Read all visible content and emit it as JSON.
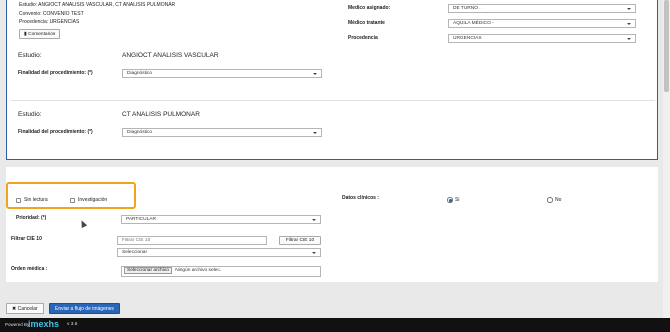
{
  "top": {
    "estudio_line": "Estudio: ANGIOCT ANALISIS VASCULAR, CT ANALISIS PULMONAR",
    "convenio_line": "Convenio: CONVENIO TEST",
    "procedencia_line": "Procedencia: URGENCIAS",
    "comentarios_label": "Comentarios",
    "medico_asignado_label": "Medico asignado:",
    "medico_asignado_value": "DE TURNO .",
    "medico_tratante_label": "Médico tratante",
    "medico_tratante_value": "AQUILA MÉDICO -",
    "procedencia_label": "Procedencia",
    "procedencia_value": "URGENCIAS"
  },
  "studies": [
    {
      "label": "Estudio:",
      "name": "ANGIOCT ANALISIS VASCULAR",
      "finalidad_label": "Finalidad del procedimiento: (*)",
      "finalidad_value": "Diagnóstico"
    },
    {
      "label": "Estudio:",
      "name": "CT ANALISIS PULMONAR",
      "finalidad_label": "Finalidad del procedimiento: (*)",
      "finalidad_value": "Diagnóstico"
    }
  ],
  "options": {
    "sin_lectura_label": "Sin lectura",
    "investigacion_label": "Investigación",
    "datos_clinicos_label": "Datos clínicos :",
    "si_label": "Si",
    "no_label": "No"
  },
  "form": {
    "prioridad_label": "Prioridad: (*)",
    "prioridad_value": "PARTICULAR",
    "filtrar_cie_label": "Filtrar CIE 10",
    "filtrar_cie_placeholder": "Filtrar CIE 10",
    "filtrar_cie_button": "Filtrar CIE 10",
    "cie_select_value": "Seleccionar",
    "orden_medica_label": "Orden médica :",
    "file_button": "Seleccionar archivo",
    "file_status": "Ningún archivo selec."
  },
  "actions": {
    "cancel_label": "Cancelar",
    "send_label": "Enviar a flujo de imágenes"
  },
  "footer": {
    "powered_by": "Powered By",
    "brand": "imexhs",
    "version": "v 3.6"
  }
}
